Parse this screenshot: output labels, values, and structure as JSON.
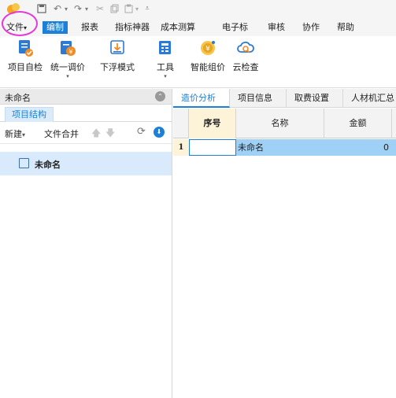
{
  "quick_access": {
    "icons": [
      "app-logo-icon",
      "save-icon",
      "undo-icon",
      "redo-icon",
      "cut-icon",
      "copy-icon",
      "paste-icon",
      "customize-icon"
    ]
  },
  "menubar": {
    "items": [
      {
        "label": "文件"
      },
      {
        "label": "编制"
      },
      {
        "label": "报表"
      },
      {
        "label": "指标神器"
      },
      {
        "label": "成本测算"
      },
      {
        "label": "电子标"
      },
      {
        "label": "审核"
      },
      {
        "label": "协作"
      },
      {
        "label": "帮助"
      }
    ],
    "file_arrow": "▾"
  },
  "ribbon": {
    "buttons": [
      {
        "label": "项目自检",
        "color": "#2c7ad6"
      },
      {
        "label": "统一调价",
        "color": "#f08c24"
      },
      {
        "label": "下浮模式",
        "color": "#2c7ad6"
      },
      {
        "label": "工具",
        "color": "#2c7ad6"
      },
      {
        "label": "智能组价",
        "color": "#e8a524"
      },
      {
        "label": "云检查",
        "color": "#2c7ad6"
      }
    ],
    "dropdown_mark": "▾"
  },
  "left_panel": {
    "project_title": "未命名",
    "tab_label": "项目结构",
    "new_label": "新建",
    "new_arrow": "▾",
    "merge_label": "文件合并",
    "up_arrow": "🡅",
    "down_arrow": "🡇",
    "refresh_glyph": "⟳",
    "download_glyph": "⬇",
    "collapse_glyph": "⌃",
    "tree_item": "未命名"
  },
  "right_panel": {
    "tabs": [
      "造价分析",
      "项目信息",
      "取费设置",
      "人材机汇总"
    ],
    "columns": [
      "序号",
      "名称",
      "金额"
    ],
    "rows": [
      {
        "index": "1",
        "seq": "",
        "name": "未命名",
        "amount": "0"
      }
    ]
  },
  "colors": {
    "accent": "#1d80d8",
    "highlight": "#e23ad8",
    "selected_row": "#9fd0f5"
  }
}
